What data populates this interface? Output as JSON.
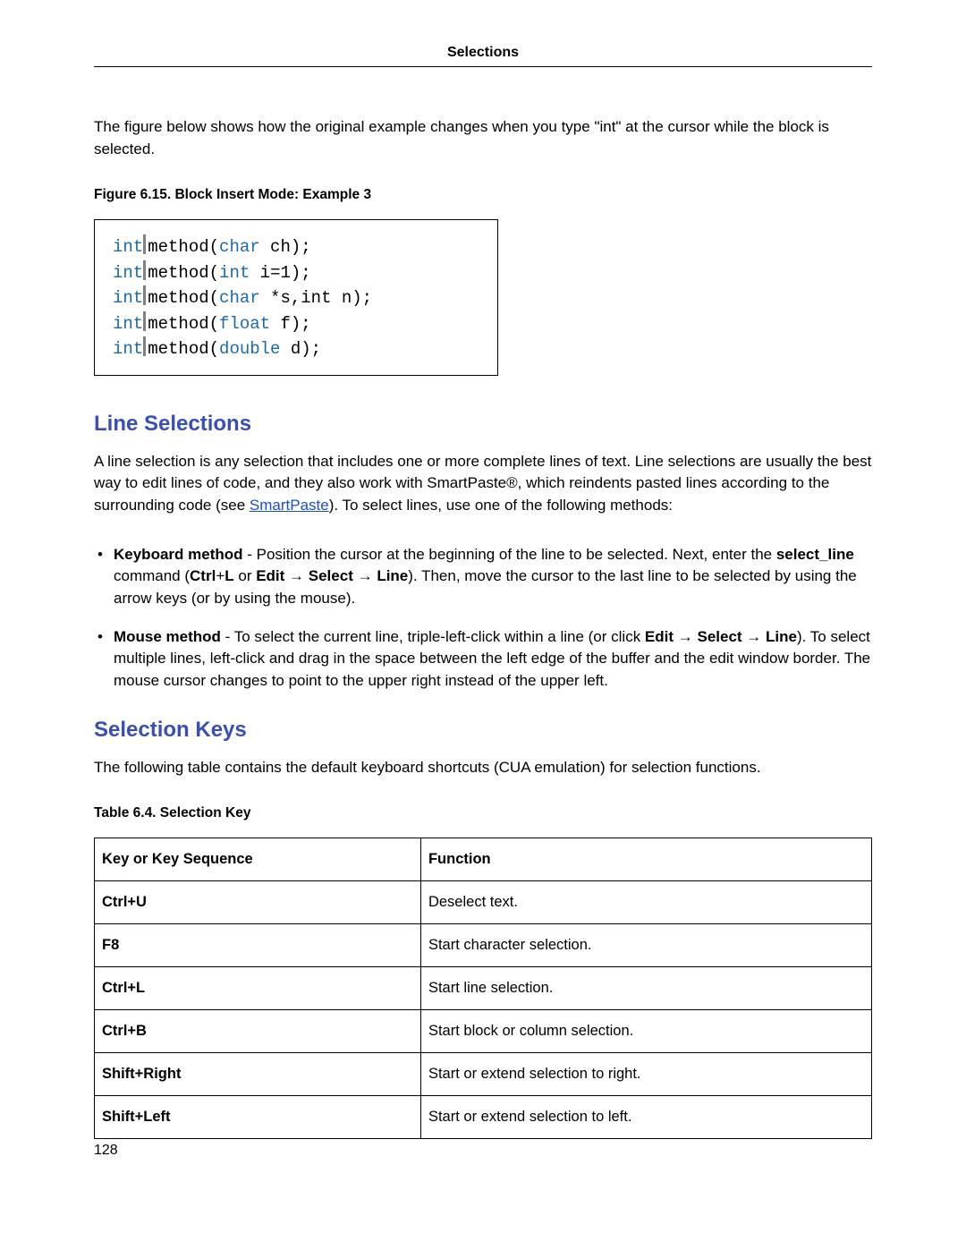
{
  "header": {
    "running": "Selections"
  },
  "intro_para": "The figure below shows how the original example changes when you type \"int\" at the cursor while the block is selected.",
  "figure": {
    "caption": "Figure 6.15.  Block Insert Mode: Example 3",
    "lines": [
      {
        "kw": "int",
        "rest_pre": " ",
        "rest_kw": null,
        "rest_after": "method(",
        "arg_kw": "char",
        "arg_rest": " ch);"
      },
      {
        "kw": "int",
        "rest_pre": " ",
        "rest_kw": null,
        "rest_after": "method(",
        "arg_kw": "int",
        "arg_rest": " i=1);"
      },
      {
        "kw": "int",
        "rest_pre": " ",
        "rest_kw": null,
        "rest_after": "method(",
        "arg_kw": "char",
        "arg_rest": " *s,int n);"
      },
      {
        "kw": "int",
        "rest_pre": " ",
        "rest_kw": null,
        "rest_after": "method(",
        "arg_kw": "float",
        "arg_rest": " f);"
      },
      {
        "kw": "int",
        "rest_pre": " ",
        "rest_kw": null,
        "rest_after": "method(",
        "arg_kw": "double",
        "arg_rest": " d);"
      }
    ]
  },
  "sections": {
    "line_sel_title": "Line Selections",
    "line_sel_para_before_link": "A line selection is any selection that includes one or more complete lines of text. Line selections are usually the best way to edit lines of code, and they also work with SmartPaste®, which reindents pasted lines according to the surrounding code (see ",
    "line_sel_link": "SmartPaste",
    "line_sel_para_after_link": "). To select lines, use one of the following methods:",
    "keyboard_method": {
      "lead_bold": "Keyboard method",
      "text1": " - Position the cursor at the beginning of the line to be selected. Next, enter the ",
      "cmd_bold": "select_line",
      "text2": " command (",
      "k1": "Ctrl",
      "plus1": "+",
      "k2": "L",
      "or": " or ",
      "m1": "Edit",
      "arrow": " → ",
      "m2": "Select",
      "m3": "Line",
      "text3": "). Then, move the cursor to the last line to be selected by using the arrow keys (or by using the mouse)."
    },
    "mouse_method": {
      "lead_bold": "Mouse method",
      "text1": " - To select the current line, triple-left-click within a line (or click ",
      "m1": "Edit",
      "arrow": " → ",
      "m2": "Select",
      "m3": "Line",
      "text2": "). To select multiple lines, left-click and drag in the space between the left edge of the buffer and the edit window border. The mouse cursor changes to point to the upper right instead of the upper left."
    },
    "sel_keys_title": "Selection Keys",
    "sel_keys_para": "The following table contains the default keyboard shortcuts (CUA emulation) for selection functions."
  },
  "table": {
    "caption": "Table 6.4. Selection Key",
    "head_key": "Key or Key Sequence",
    "head_func": "Function",
    "rows": [
      {
        "key": "Ctrl+U",
        "func": "Deselect text."
      },
      {
        "key": "F8",
        "func": "Start character selection."
      },
      {
        "key": "Ctrl+L",
        "func": "Start line selection."
      },
      {
        "key": "Ctrl+B",
        "func": "Start block or column selection."
      },
      {
        "key": "Shift+Right",
        "func": "Start or extend selection to right."
      },
      {
        "key": "Shift+Left",
        "func": "Start or extend selection to left."
      }
    ]
  },
  "page_number": "128"
}
